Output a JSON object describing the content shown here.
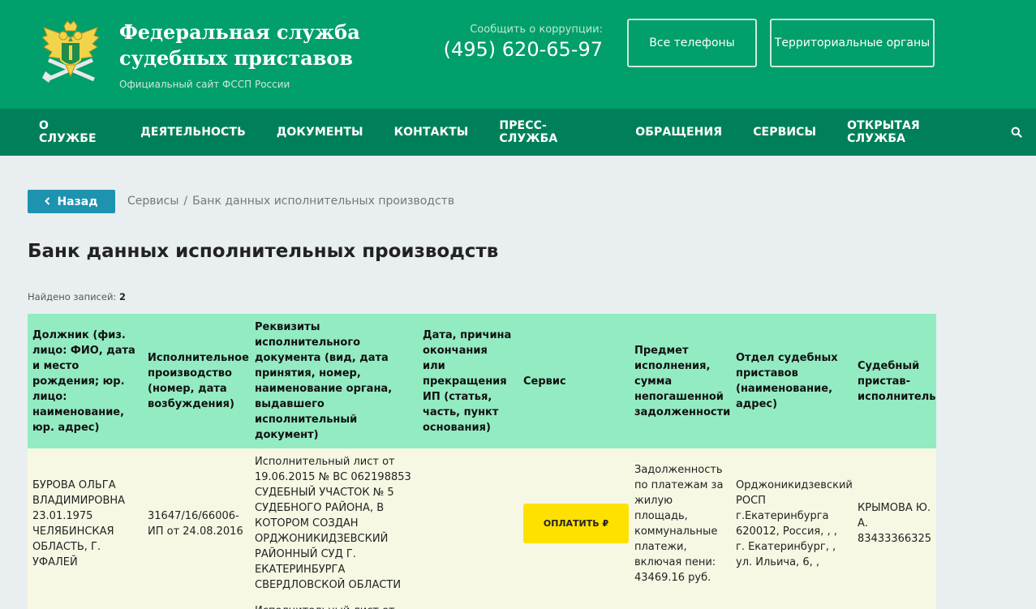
{
  "header": {
    "title": "Федеральная служба судебных приставов",
    "subtitle": "Официальный сайт ФССП России",
    "corruption_label": "Сообщить о коррупции:",
    "corruption_phone": "(495) 620-65-97",
    "btn_all_phones": "Все телефоны",
    "btn_territorial": "Территориальные органы"
  },
  "nav": {
    "items": [
      "О СЛУЖБЕ",
      "ДЕЯТЕЛЬНОСТЬ",
      "ДОКУМЕНТЫ",
      "КОНТАКТЫ",
      "ПРЕСС-СЛУЖБА",
      "ОБРАЩЕНИЯ",
      "СЕРВИСЫ",
      "ОТКРЫТАЯ СЛУЖБА"
    ],
    "search_icon": "search-icon"
  },
  "breadcrumb": {
    "back_label": "Назад",
    "items": [
      "Сервисы",
      "Банк данных исполнительных производств"
    ],
    "separator": "/"
  },
  "page": {
    "title": "Банк данных исполнительных производств",
    "found_label": "Найдено записей:",
    "found_count": "2"
  },
  "table": {
    "headers": [
      "Должник (физ. лицо: ФИО, дата и место рождения; юр. лицо: наименование, юр. адрес)",
      "Исполнительное производство (номер, дата возбуждения)",
      "Реквизиты исполнительного документа (вид, дата принятия, номер, наименование органа, выдавшего исполнительный документ)",
      "Дата, причина окончания или прекращения ИП (статья, часть, пункт основания)",
      "Сервис",
      "Предмет исполнения, сумма непогашенной задолженности",
      "Отдел судебных приставов (наименование, адрес)",
      "Судебный пристав-исполнитель"
    ],
    "rows": [
      {
        "debtor": "БУРОВА ОЛЬГА ВЛАДИМИРОВНА 23.01.1975 ЧЕЛЯБИНСКАЯ ОБЛАСТЬ, Г. УФАЛЕЙ",
        "proceeding": "31647/16/66006-ИП от 24.08.2016",
        "document": "Исполнительный лист от 19.06.2015 № ВС 062198853 СУДЕБНЫЙ УЧАСТОК № 5 СУДЕБНОГО РАЙОНА, В КОТОРОМ СОЗДАН ОРДЖОНИКИДЗЕВСКИЙ РАЙОННЫЙ СУД Г. ЕКАТЕРИНБУРГА СВЕРДЛОВСКОЙ ОБЛАСТИ",
        "end_reason": "",
        "service_label": "ОПЛАТИТЬ ₽",
        "subject": "Задолженность по платежам за жилую площадь, коммунальные платежи, включая пени: 43469.16 руб.",
        "department": "Орджоникидзевский РОСП г.Екатеринбурга 620012, Россия, , , г. Екатеринбург, , ул. Ильича, 6, ,",
        "bailiff": "КРЫМОВА Ю. А. 83433366325"
      }
    ],
    "row2_partial": "Исполнительный лист от"
  },
  "colors": {
    "header_bg": "#009f6b",
    "nav_bg": "#00805a",
    "table_header_bg": "#93ebc2",
    "row_bg": "#f6f8e4",
    "pay_button": "#ffe100",
    "back_button": "#1e93b0"
  }
}
